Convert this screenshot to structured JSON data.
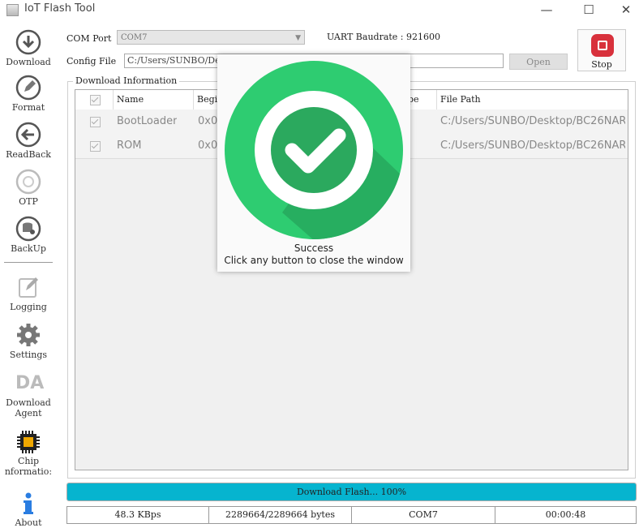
{
  "window": {
    "title": "IoT Flash Tool",
    "minimize_glyph": "—",
    "maximize_glyph": "☐",
    "close_glyph": "✕"
  },
  "sidebar": {
    "items": [
      {
        "label": "Download",
        "icon": "download-icon"
      },
      {
        "label": "Format",
        "icon": "format-icon"
      },
      {
        "label": "ReadBack",
        "icon": "readback-icon"
      },
      {
        "label": "OTP",
        "icon": "otp-icon"
      },
      {
        "label": "BackUp",
        "icon": "backup-icon"
      },
      {
        "label": "Logging",
        "icon": "logging-icon"
      },
      {
        "label": "Settings",
        "icon": "gear-icon"
      },
      {
        "label_line1": "Download",
        "label_line2": "Agent",
        "icon": "download-agent-icon",
        "icon_text": "DA"
      },
      {
        "label_line1": "Chip",
        "label_line2": "nformatio:",
        "icon": "chip-icon"
      },
      {
        "label": "About",
        "icon": "info-icon"
      }
    ]
  },
  "controls": {
    "com_port_label": "COM Port",
    "com_port_value": "COM7",
    "uart_label": "UART Baudrate : 921600",
    "config_file_label": "Config File",
    "config_file_value": "C:/Users/SUNBO/Desk",
    "open_label": "Open",
    "stop_label": "Stop"
  },
  "download_info": {
    "title": "Download Information",
    "columns": [
      "Name",
      "Begi",
      "pe",
      "File Path"
    ],
    "rows": [
      {
        "name": "BootLoader",
        "begin": "0x0",
        "file_path": "C:/Users/SUNBO/Desktop/BC26NAR..."
      },
      {
        "name": "ROM",
        "begin": "0x0",
        "file_path": "C:/Users/SUNBO/Desktop/BC26NAR..."
      }
    ]
  },
  "progress": {
    "text": "Download Flash... 100%",
    "fraction": 1.0
  },
  "status": {
    "speed": "48.3 KBps",
    "bytes": "2289664/2289664 bytes",
    "port": "COM7",
    "time": "00:00:48"
  },
  "popup": {
    "icon": "success-check-icon",
    "line1": "Success",
    "line2": "Click any button to close the window"
  },
  "colors": {
    "accent": "#06b4cf",
    "stop": "#d8313c",
    "success_green": "#2ecc71",
    "success_dark": "#27ae60"
  }
}
